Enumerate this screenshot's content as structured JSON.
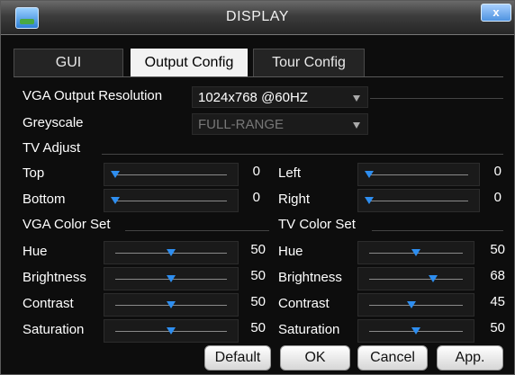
{
  "window": {
    "title": "DISPLAY",
    "close_label": "x"
  },
  "tabs": [
    {
      "label": "GUI",
      "active": false
    },
    {
      "label": "Output Config",
      "active": true
    },
    {
      "label": "Tour Config",
      "active": false
    }
  ],
  "vga_output": {
    "label": "VGA Output  Resolution",
    "value": "1024x768 @60HZ"
  },
  "greyscale": {
    "label": "Greyscale",
    "value": "FULL-RANGE"
  },
  "tv_adjust": {
    "title": "TV Adjust",
    "top": {
      "label": "Top",
      "value": "0",
      "level": 0
    },
    "left": {
      "label": "Left",
      "value": "0",
      "level": 0
    },
    "bottom": {
      "label": "Bottom",
      "value": "0",
      "level": 0
    },
    "right": {
      "label": "Right",
      "value": "0",
      "level": 0
    }
  },
  "vga_color": {
    "title": "VGA Color Set",
    "hue": {
      "label": "Hue",
      "value": "50",
      "level": 50
    },
    "brightness": {
      "label": "Brightness",
      "value": "50",
      "level": 50
    },
    "contrast": {
      "label": "Contrast",
      "value": "50",
      "level": 50
    },
    "saturation": {
      "label": "Saturation",
      "value": "50",
      "level": 50
    }
  },
  "tv_color": {
    "title": "TV Color Set",
    "hue": {
      "label": "Hue",
      "value": "50",
      "level": 50
    },
    "brightness": {
      "label": "Brightness",
      "value": "68",
      "level": 68
    },
    "contrast": {
      "label": "Contrast",
      "value": "45",
      "level": 45
    },
    "saturation": {
      "label": "Saturation",
      "value": "50",
      "level": 50
    }
  },
  "buttons": {
    "default": "Default",
    "ok": "OK",
    "cancel": "Cancel",
    "apply": "App."
  },
  "colors": {
    "accent": "#2e8ef0",
    "active_tab": "#f2f2f2",
    "background": "#0d0d0d"
  }
}
